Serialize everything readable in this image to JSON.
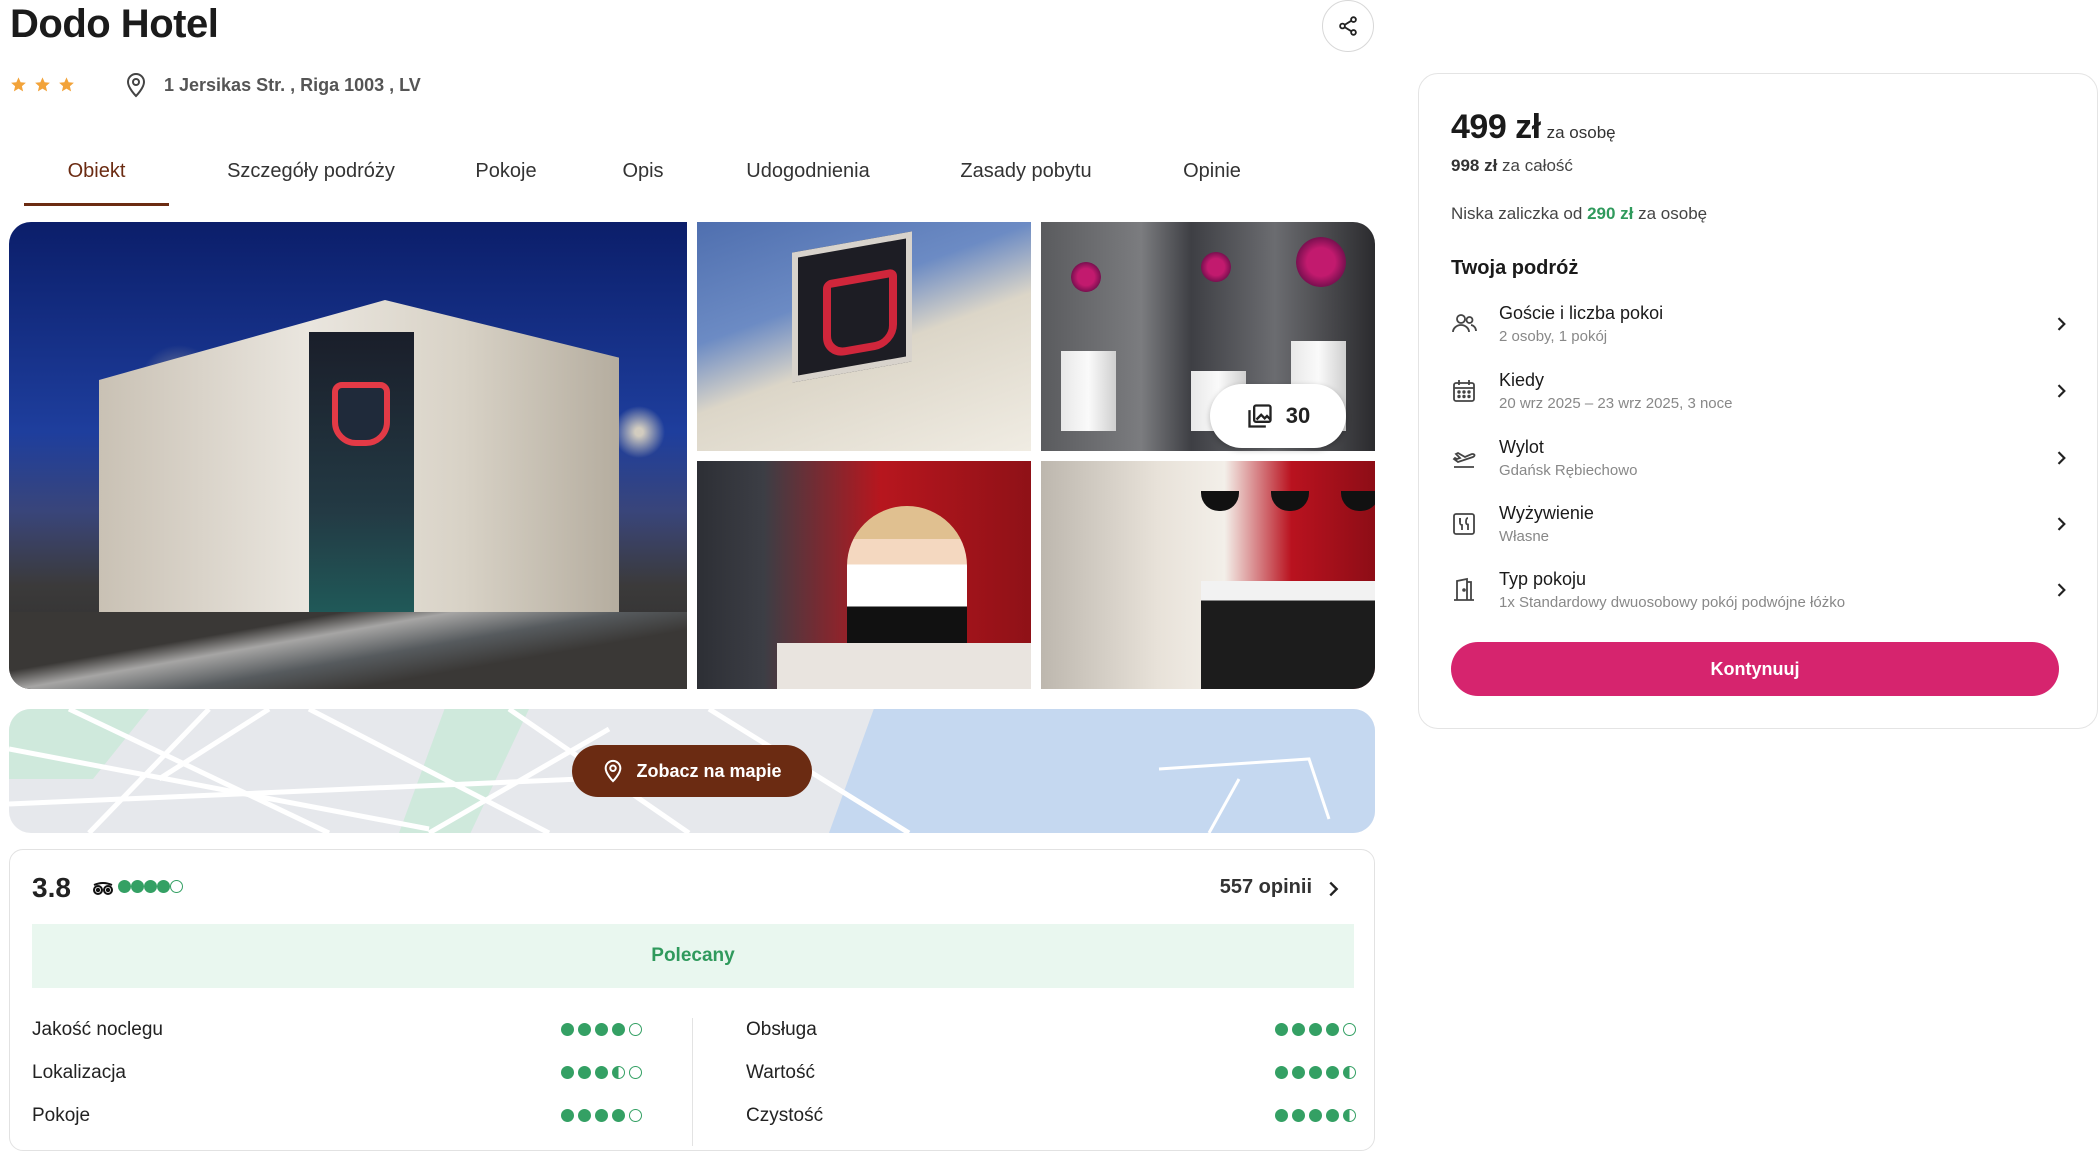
{
  "header": {
    "title": "Dodo Hotel",
    "stars": 3,
    "address": "1 Jersikas Str. , Riga 1003 , LV"
  },
  "tabs": [
    {
      "label": "Obiekt",
      "active": true
    },
    {
      "label": "Szczegóły podróży",
      "active": false
    },
    {
      "label": "Pokoje",
      "active": false
    },
    {
      "label": "Opis",
      "active": false
    },
    {
      "label": "Udogodnienia",
      "active": false
    },
    {
      "label": "Zasady pobytu",
      "active": false
    },
    {
      "label": "Opinie",
      "active": false
    }
  ],
  "gallery": {
    "photo_count": "30"
  },
  "map": {
    "button_label": "Zobacz na mapie"
  },
  "reviews": {
    "score": "3.8",
    "tripadvisor_rating": 4,
    "count_label": "557 opinii",
    "recommended_label": "Polecany",
    "categories_left": [
      {
        "label": "Jakość noclegu",
        "rating": 4
      },
      {
        "label": "Lokalizacja",
        "rating": 3.5
      },
      {
        "label": "Pokoje",
        "rating": 4
      }
    ],
    "categories_right": [
      {
        "label": "Obsługa",
        "rating": 4
      },
      {
        "label": "Wartość",
        "rating": 4.5
      },
      {
        "label": "Czystość",
        "rating": 4.5
      }
    ]
  },
  "booking": {
    "price": "499 zł",
    "price_per": "za osobę",
    "total_amount": "998 zł",
    "total_label": "za całość",
    "deposit_prefix": "Niska zaliczka od",
    "deposit_amount": "290 zł",
    "deposit_suffix": "za osobę",
    "trip_title": "Twoja podróż",
    "trip_items": [
      {
        "title": "Goście i liczba pokoi",
        "value": "2 osoby, 1 pokój",
        "icon": "guests-icon"
      },
      {
        "title": "Kiedy",
        "value": "20 wrz 2025 – 23 wrz 2025, 3 noce",
        "icon": "calendar-icon"
      },
      {
        "title": "Wylot",
        "value": "Gdańsk Rębiechowo",
        "icon": "plane-departure-icon"
      },
      {
        "title": "Wyżywienie",
        "value": "Własne",
        "icon": "meal-icon"
      },
      {
        "title": "Typ pokoju",
        "value": "1x Standardowy dwuosobowy pokój podwójne łóżko",
        "icon": "room-door-icon"
      }
    ],
    "continue_label": "Kontynuuj"
  },
  "colors": {
    "brand_brown": "#6b2b12",
    "accent_pink": "#d6246e",
    "rating_green": "#34a064",
    "star_orange": "#f2a33a"
  }
}
